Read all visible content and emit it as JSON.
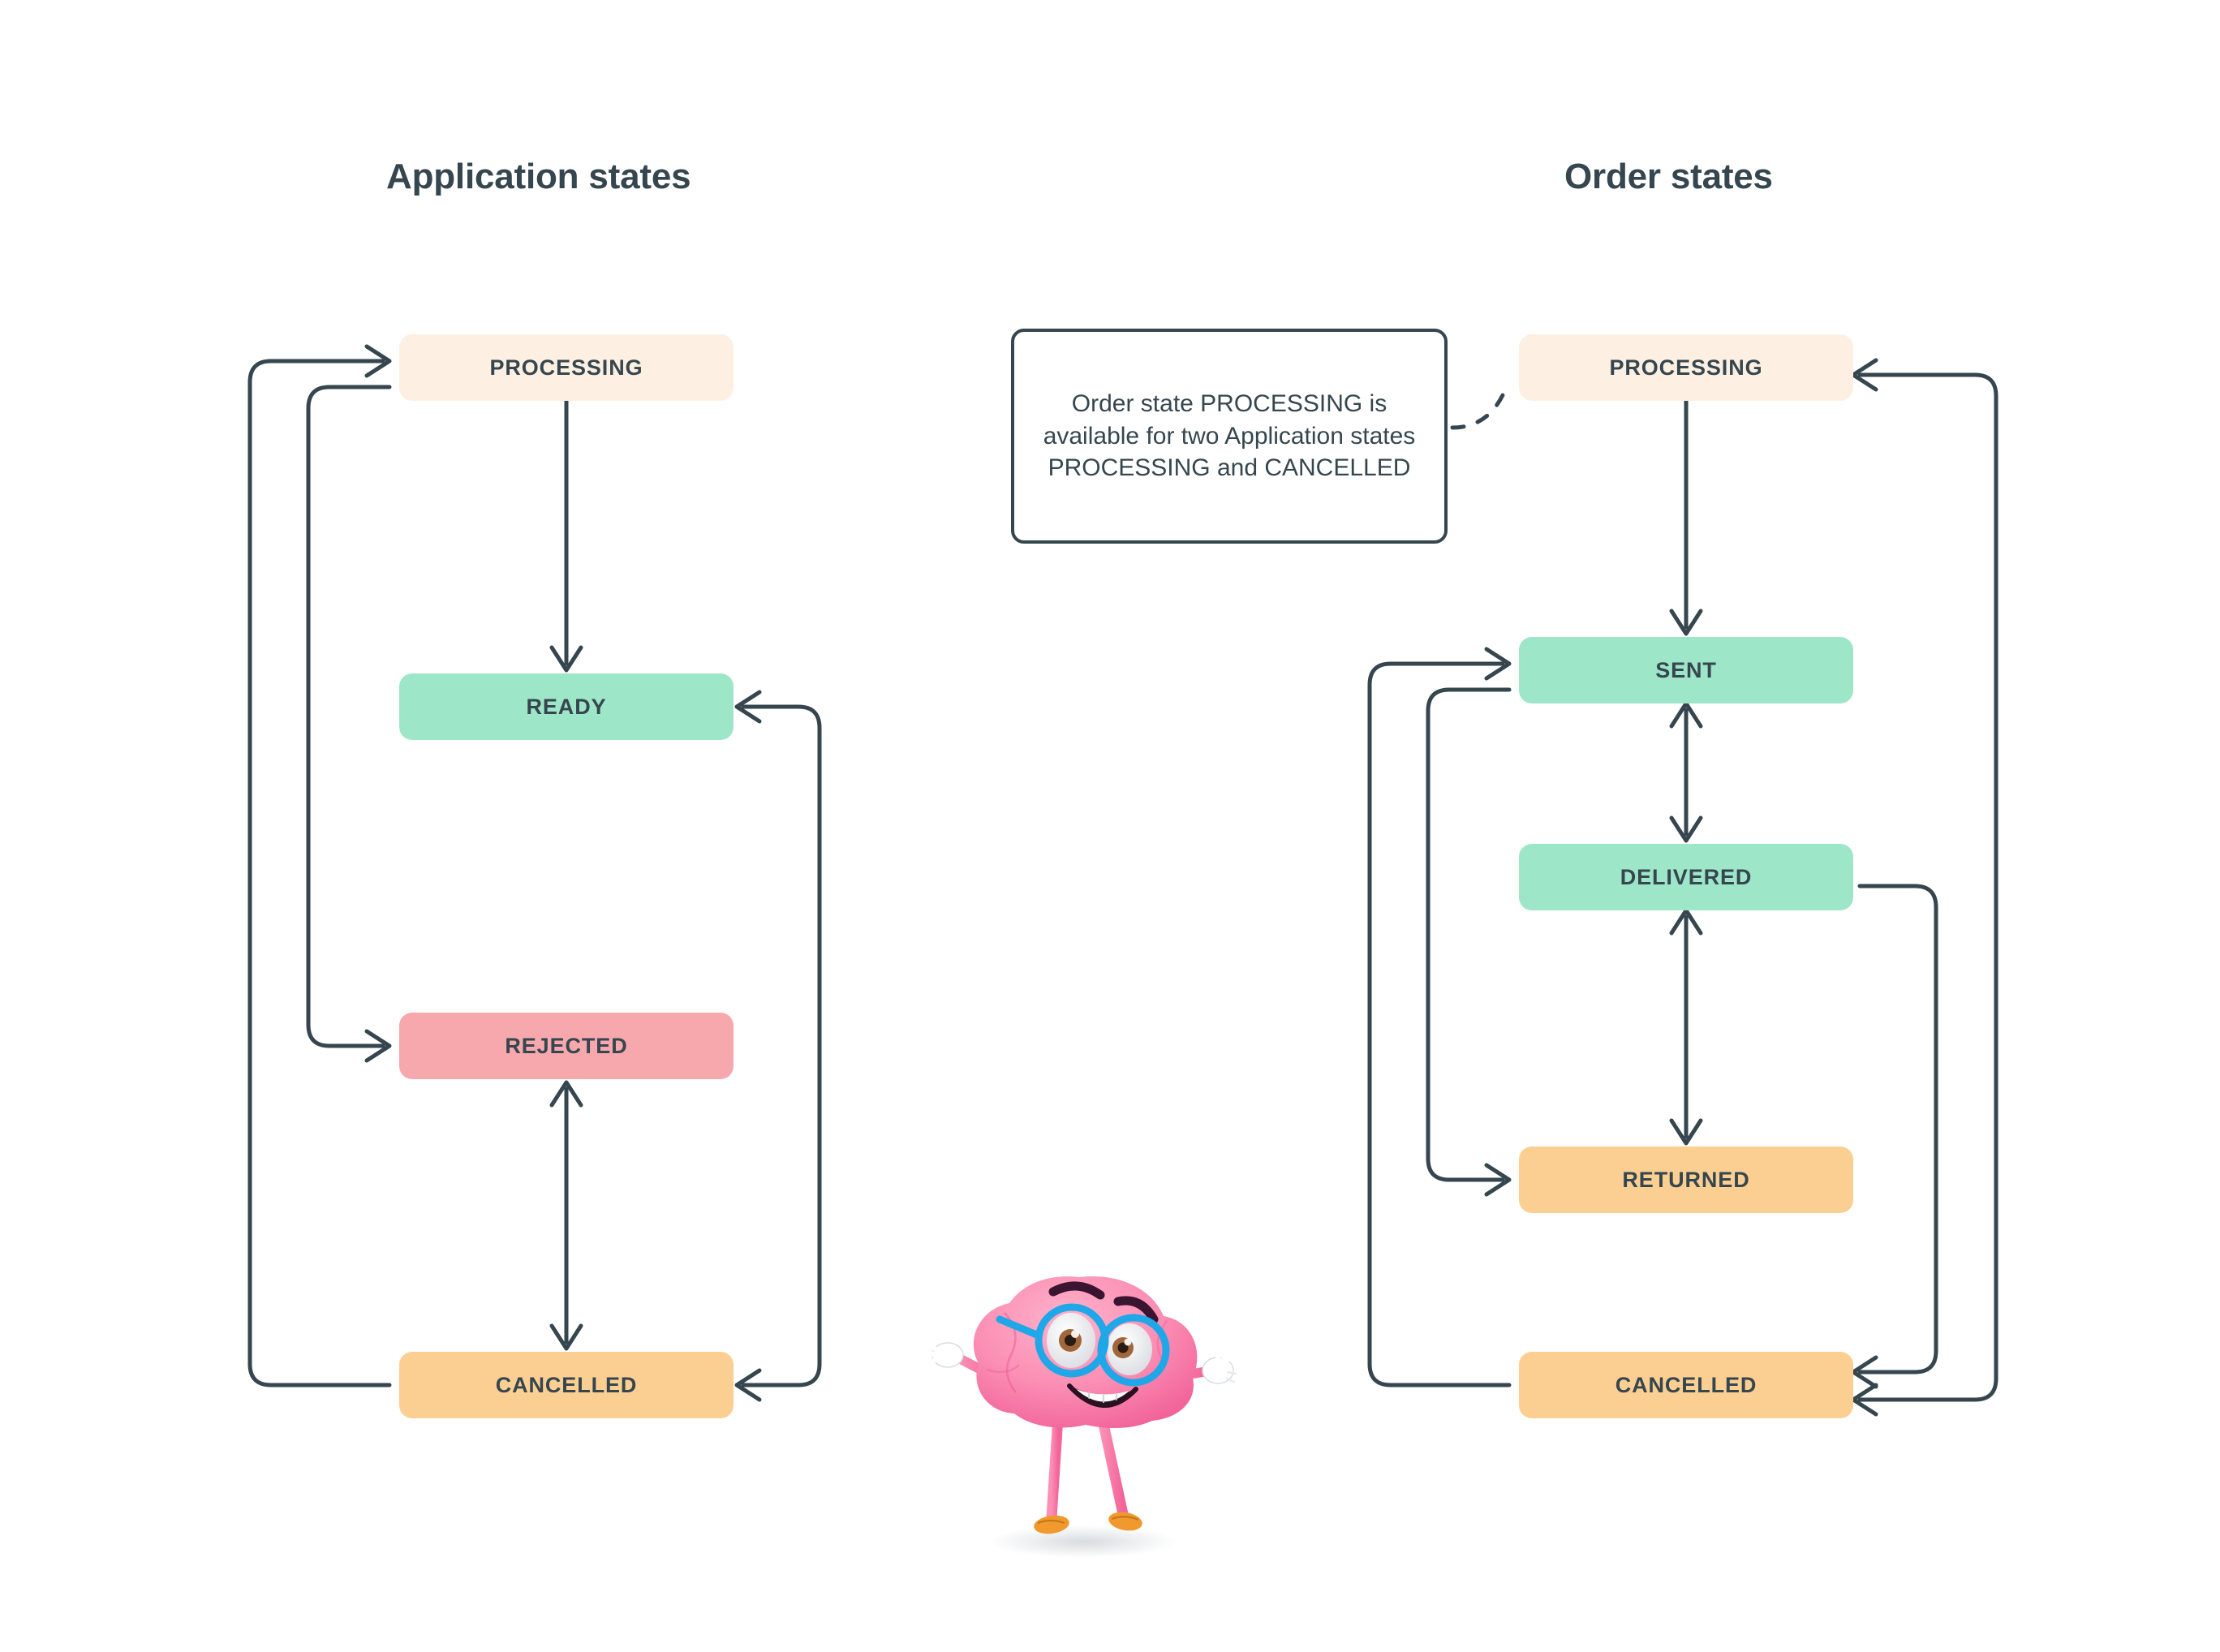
{
  "page": {
    "background": "#ffffff",
    "ink": "#36464F"
  },
  "columns": [
    {
      "id": "application",
      "title": "Application states",
      "states": [
        {
          "id": "app-processing",
          "label": "PROCESSING",
          "color": "#FDF0E2"
        },
        {
          "id": "app-ready",
          "label": "READY",
          "color": "#9EE6C8"
        },
        {
          "id": "app-rejected",
          "label": "REJECTED",
          "color": "#F7A8AC"
        },
        {
          "id": "app-cancelled",
          "label": "CANCELLED",
          "color": "#FBCF92"
        }
      ],
      "transitions": [
        {
          "from": "PROCESSING",
          "to": "READY",
          "type": "straight",
          "direction": "one-way"
        },
        {
          "from": "PROCESSING",
          "to": "REJECTED",
          "type": "loop-left-inner",
          "direction": "one-way"
        },
        {
          "from": "CANCELLED",
          "to": "PROCESSING",
          "type": "loop-left-outer",
          "direction": "one-way"
        },
        {
          "from": "REJECTED",
          "to": "CANCELLED",
          "type": "straight",
          "direction": "two-way"
        },
        {
          "from": "READY",
          "to": "CANCELLED",
          "type": "loop-right",
          "direction": "two-way"
        }
      ]
    },
    {
      "id": "order",
      "title": "Order states",
      "states": [
        {
          "id": "ord-processing",
          "label": "PROCESSING",
          "color": "#FDF0E2"
        },
        {
          "id": "ord-sent",
          "label": "SENT",
          "color": "#9EE6C8"
        },
        {
          "id": "ord-delivered",
          "label": "DELIVERED",
          "color": "#9EE6C8"
        },
        {
          "id": "ord-returned",
          "label": "RETURNED",
          "color": "#FBCF92"
        },
        {
          "id": "ord-cancelled",
          "label": "CANCELLED",
          "color": "#FBCF92"
        }
      ],
      "transitions": [
        {
          "from": "PROCESSING",
          "to": "SENT",
          "type": "straight",
          "direction": "one-way"
        },
        {
          "from": "SENT",
          "to": "DELIVERED",
          "type": "straight",
          "direction": "two-way"
        },
        {
          "from": "DELIVERED",
          "to": "RETURNED",
          "type": "straight",
          "direction": "two-way"
        },
        {
          "from": "SENT",
          "to": "RETURNED",
          "type": "loop-left-inner",
          "direction": "one-way"
        },
        {
          "from": "CANCELLED",
          "to": "SENT",
          "type": "loop-left-outer",
          "direction": "one-way"
        },
        {
          "from": "DELIVERED",
          "to": "CANCELLED",
          "type": "loop-right-inner",
          "direction": "one-way"
        },
        {
          "from": "PROCESSING",
          "to": "CANCELLED",
          "type": "loop-right-outer",
          "direction": "two-way"
        }
      ]
    }
  ],
  "annotation": {
    "text": "Order state PROCESSING is available for two Application states PROCESSING  and CANCELLED",
    "connector": "dashed",
    "points_to": "ord-processing"
  },
  "mascot": {
    "name": "brain-character",
    "description": "pink brain character with blue glasses",
    "colors": {
      "body": "#F9799E",
      "body_light": "#FB9FBE",
      "glasses": "#20A7E8",
      "glove": "#FFFFFF",
      "shoe": "#F09A2E",
      "brow": "#3A1430"
    }
  }
}
